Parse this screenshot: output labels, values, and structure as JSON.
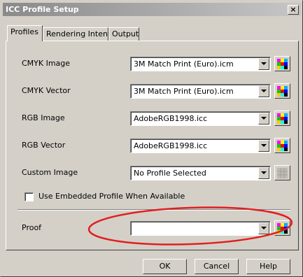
{
  "window": {
    "title": "ICC Profile Setup",
    "close_label": "×"
  },
  "tabs": [
    {
      "label": "Profiles",
      "active": true
    },
    {
      "label": "Rendering Intents",
      "active": false
    },
    {
      "label": "Output",
      "active": false
    }
  ],
  "profiles": {
    "rows": [
      {
        "label": "CMYK Image",
        "value": "3M Match Print (Euro).icm",
        "swatch_enabled": true
      },
      {
        "label": "CMYK Vector",
        "value": "3M Match Print (Euro).icm",
        "swatch_enabled": true
      },
      {
        "label": "RGB Image",
        "value": "AdobeRGB1998.icc",
        "swatch_enabled": true
      },
      {
        "label": "RGB Vector",
        "value": "AdobeRGB1998.icc",
        "swatch_enabled": true
      },
      {
        "label": "Custom Image",
        "value": "No Profile Selected",
        "swatch_enabled": false
      }
    ],
    "embedded_checkbox": {
      "label": "Use Embedded Profile When Available",
      "checked": false
    },
    "proof": {
      "label": "Proof",
      "value": "",
      "swatch_enabled": true
    }
  },
  "buttons": {
    "ok": "OK",
    "cancel": "Cancel",
    "help": "Help"
  },
  "annotation": {
    "color": "#e02020"
  },
  "icons": {
    "dropdown": "chevron-down-icon",
    "color_profile": "color-palette-icon",
    "close": "close-icon"
  }
}
